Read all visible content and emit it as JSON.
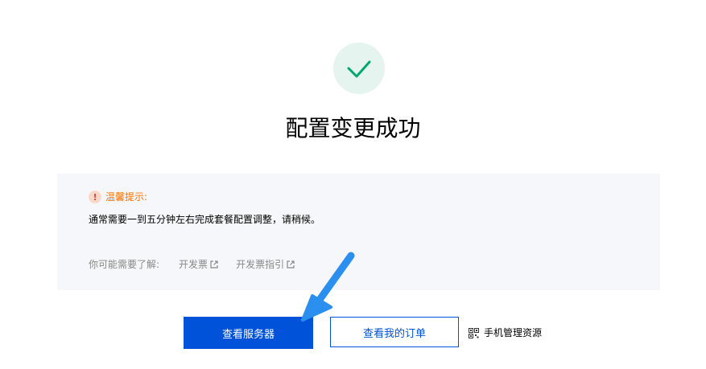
{
  "result": {
    "title": "配置变更成功",
    "icon": "checkmark-icon",
    "accent_color": "#00a870"
  },
  "notice": {
    "title": "温馨提示:",
    "icon": "warning-icon",
    "message": "通常需要一到五分钟左右完成套餐配置调整，请稍候。",
    "links_label": "你可能需要了解:",
    "links": [
      {
        "label": "开发票",
        "icon": "external-link-icon"
      },
      {
        "label": "开发票指引",
        "icon": "external-link-icon"
      }
    ]
  },
  "actions": {
    "primary_label": "查看服务器",
    "secondary_label": "查看我的订单",
    "mobile_label": "手机管理资源",
    "mobile_icon": "qr-code-icon",
    "primary_color": "#0052d9"
  },
  "annotation": {
    "arrow_color": "#2b8ff0",
    "arrow_icon": "arrow-annotation"
  }
}
